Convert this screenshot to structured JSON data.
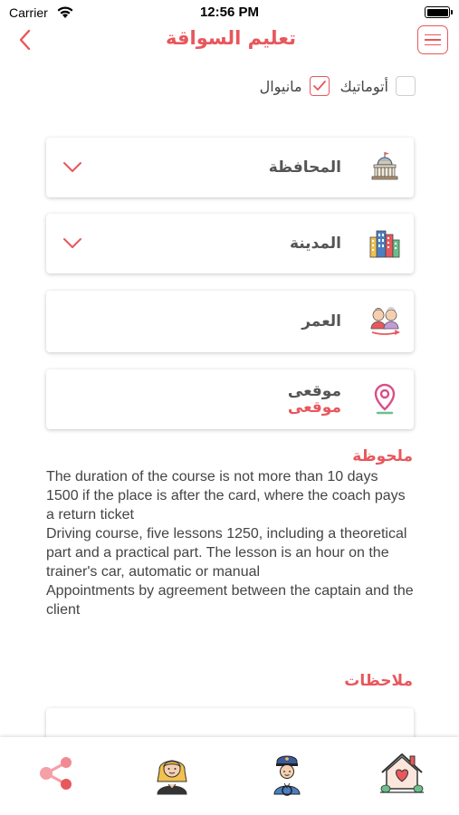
{
  "status_bar": {
    "carrier": "Carrier",
    "time": "12:56 PM"
  },
  "nav": {
    "title": "تعليم السواقة",
    "accent_color": "#e8575c"
  },
  "transmission": {
    "manual_label": "مانيوال",
    "manual_checked": true,
    "automatic_label": "أتوماتيك",
    "automatic_checked": false
  },
  "fields": {
    "governorate_label": "المحافظة",
    "city_label": "المدينة",
    "age_label": "العمر",
    "location_label": "موقعى",
    "location_value": "موقعى"
  },
  "note": {
    "title": "ملحوظة",
    "lines": [
      "The duration of the course is not more than 10 days",
      "1500 if the place is after the card, where the coach pays a return ticket",
      "Driving course, five lessons 1250, including a theoretical part and a practical part. The lesson is an hour on the trainer's car, automatic or manual",
      "Appointments by agreement between the captain and the client"
    ]
  },
  "remarks": {
    "title": "ملاحظات"
  },
  "tabbar": {
    "icons": [
      "share-icon",
      "female-trainer-icon",
      "captain-icon",
      "home-icon"
    ]
  }
}
